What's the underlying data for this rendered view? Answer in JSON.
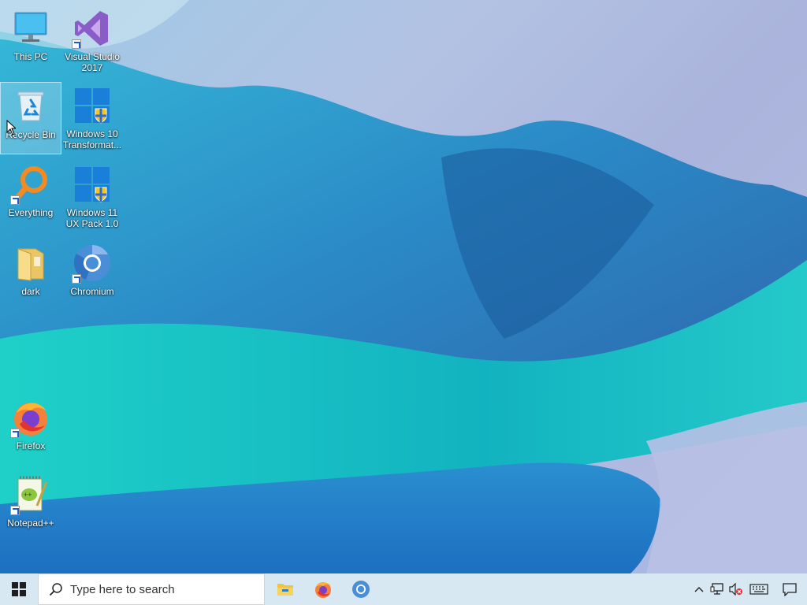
{
  "desktop": {
    "icons": [
      {
        "label": "This PC",
        "icon": "monitor-icon",
        "shortcut": false,
        "selected": false
      },
      {
        "label": "Visual Studio 2017",
        "icon": "visual-studio-icon",
        "shortcut": true,
        "selected": false
      },
      {
        "label": "Recycle Bin",
        "icon": "recycle-bin-icon",
        "shortcut": false,
        "selected": true
      },
      {
        "label": "Windows 10 Transformat...",
        "icon": "windows-logo-icon",
        "shortcut": false,
        "selected": false
      },
      {
        "label": "Everything",
        "icon": "magnifier-icon",
        "shortcut": true,
        "selected": false
      },
      {
        "label": "Windows 11 UX Pack 1.0",
        "icon": "windows-logo-icon",
        "shortcut": false,
        "selected": false
      },
      {
        "label": "dark",
        "icon": "folder-icon",
        "shortcut": false,
        "selected": false
      },
      {
        "label": "Chromium",
        "icon": "chromium-icon",
        "shortcut": true,
        "selected": false
      },
      {
        "label": "Firefox",
        "icon": "firefox-icon",
        "shortcut": true,
        "selected": false
      },
      {
        "label": "Notepad++",
        "icon": "notepad-plus-plus-icon",
        "shortcut": true,
        "selected": false
      }
    ]
  },
  "taskbar": {
    "start_icon": "windows-start-icon",
    "search": {
      "placeholder": "Type here to search",
      "icon": "search-icon"
    },
    "pinned_apps": [
      {
        "name": "File Explorer",
        "icon": "file-explorer-icon"
      },
      {
        "name": "Firefox",
        "icon": "firefox-icon"
      },
      {
        "name": "Chromium",
        "icon": "chromium-icon"
      }
    ],
    "tray": {
      "icons": [
        "chevron-up-icon",
        "network-icon",
        "volume-muted-icon",
        "keyboard-icon",
        "action-center-icon"
      ]
    }
  },
  "colors": {
    "taskbar_bg": "#d7e8f2",
    "wallpaper_teal": "#1ec6c6",
    "wallpaper_blue": "#1e7fc0",
    "wallpaper_lavender": "#b3bde3"
  }
}
